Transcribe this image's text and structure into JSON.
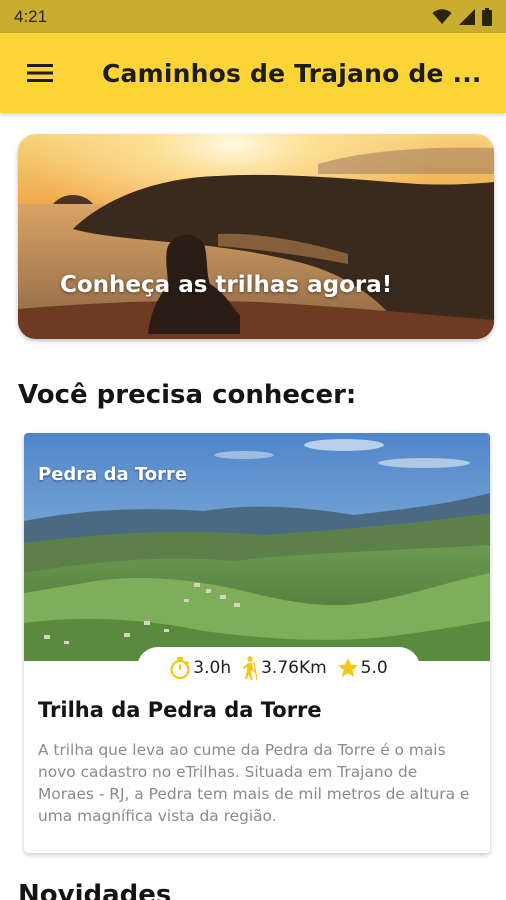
{
  "status_bar": {
    "time": "4:21",
    "icons": [
      "wifi-icon",
      "signal-icon",
      "battery-icon"
    ]
  },
  "app_bar": {
    "title": "Caminhos de Trajano de ...",
    "menu_icon": "hamburger-menu-icon"
  },
  "hero": {
    "text": "Conheça as trilhas agora!"
  },
  "section": {
    "title": "Você precisa conhecer:"
  },
  "featured_card": {
    "photo_label": "Pedra da Torre",
    "stats": {
      "duration": "3.0h",
      "distance": "3.76Km",
      "rating": "5.0",
      "icons": [
        "stopwatch-icon",
        "hiker-icon",
        "star-icon"
      ]
    },
    "title": "Trilha da Pedra da Torre",
    "description": "A trilha que leva ao cume da Pedra da Torre é o mais novo cadastro no eTrilhas. Situada em Trajano de Moraes - RJ, a Pedra tem mais de mil metros de altura e uma magnífica vista da região."
  },
  "next_section": {
    "title": "Novidades"
  },
  "colors": {
    "app_bar": "#fcd436",
    "status_bar": "#c9ad2c",
    "accent": "#f5c518",
    "body_text": "#8a8a8a"
  }
}
